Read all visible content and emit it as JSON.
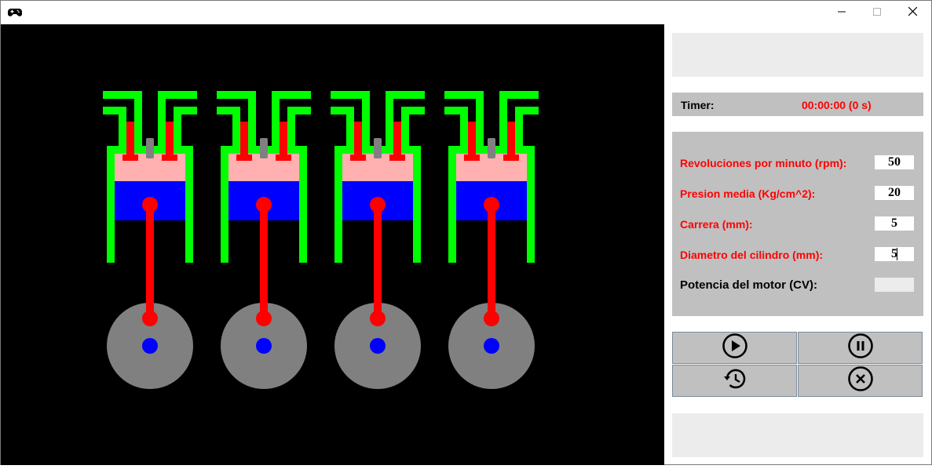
{
  "window": {
    "icon": "gamepad-icon",
    "controls": [
      "minimize-icon",
      "maximize-icon",
      "close-icon"
    ]
  },
  "canvas": {
    "background": "#000000",
    "engines": [
      {
        "cylinder": 1,
        "crank": "bottom"
      },
      {
        "cylinder": 2,
        "crank": "bottom"
      },
      {
        "cylinder": 3,
        "crank": "bottom"
      },
      {
        "cylinder": 4,
        "crank": "bottom"
      }
    ],
    "colors": {
      "wall": "#00ff00",
      "valve": "#ff0000",
      "spark_plug": "#808080",
      "combustion_chamber": "#ffb0b0",
      "piston": "#0000ff",
      "rod": "#ff0000",
      "crank_disc": "#808080",
      "crank_center": "#0000ff"
    }
  },
  "timer": {
    "label": "Timer:",
    "value": "00:00:00 (0 s)"
  },
  "params": {
    "rpm_label": "Revoluciones por minuto (rpm):",
    "rpm_value": "50",
    "pressure_label": "Presion media (Kg/cm^2):",
    "pressure_value": "20",
    "stroke_label": "Carrera (mm):",
    "stroke_value": "5",
    "diameter_label": "Diametro del cilindro (mm):",
    "diameter_value": "5",
    "power_label": "Potencia del motor (CV):",
    "power_value": ""
  },
  "controls": {
    "play_icon": "play-icon",
    "pause_icon": "pause-icon",
    "restart_icon": "history-icon",
    "stop_icon": "close-circle-icon"
  }
}
